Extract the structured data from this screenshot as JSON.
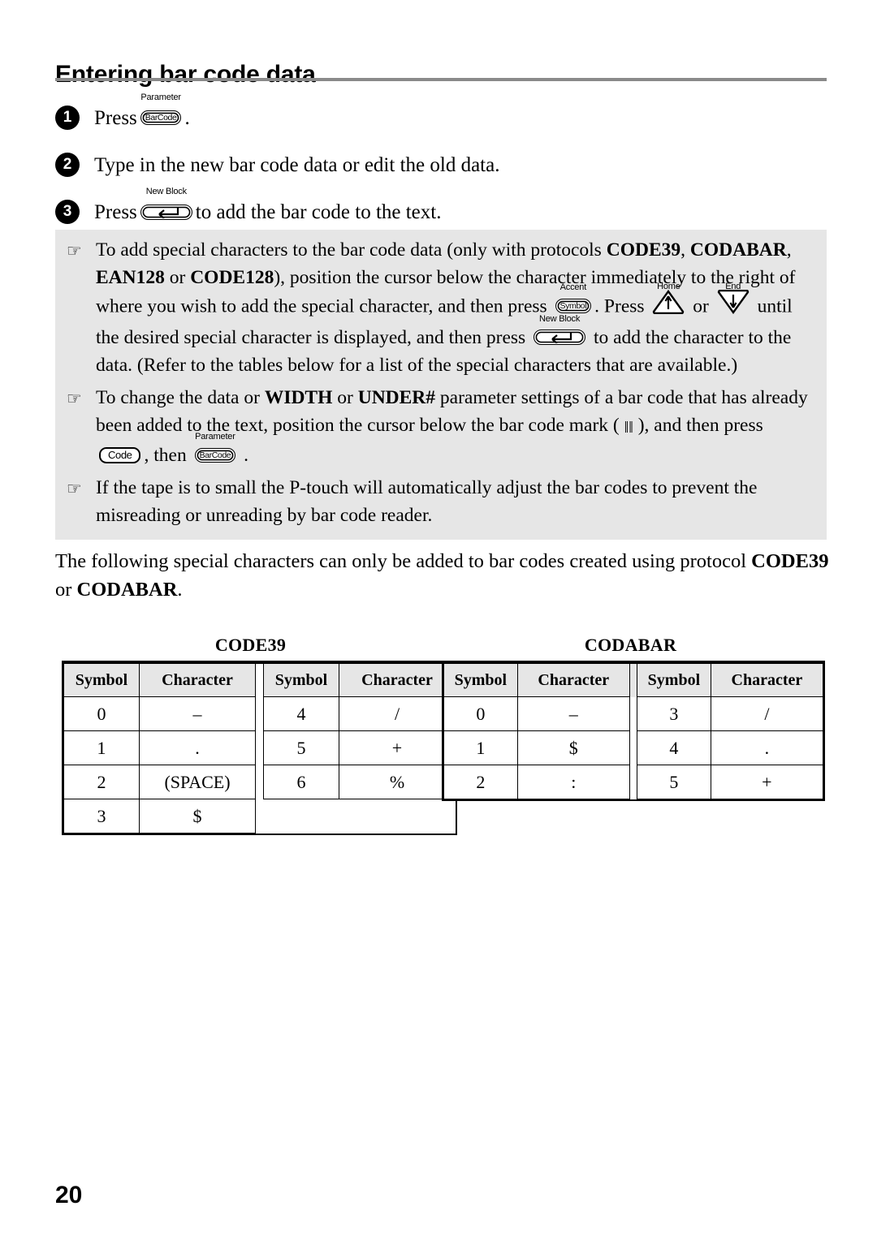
{
  "page": {
    "title": "Entering bar code data",
    "number": "20"
  },
  "steps": [
    {
      "num": "1",
      "pre": "Press",
      "key": {
        "label": "Parameter",
        "cap": "BarCode"
      },
      "post": "."
    },
    {
      "num": "2",
      "pre": "Type in the new bar code data or edit the old data.",
      "key": null,
      "post": ""
    },
    {
      "num": "3",
      "pre": "Press",
      "key": {
        "label": "New Block",
        "cap": "enter-arrow"
      },
      "post": "to add the bar code to the text."
    }
  ],
  "notes": {
    "bullet_icon": "pointing-hand-icon",
    "items": [
      {
        "segments": [
          {
            "t": "To add special characters to the bar code data (only with protocols "
          },
          {
            "t": "CODE39",
            "b": true
          },
          {
            "t": ", "
          },
          {
            "t": "CODABAR",
            "b": true
          },
          {
            "t": ", "
          },
          {
            "t": "EAN128",
            "b": true
          },
          {
            "t": " or "
          },
          {
            "t": "CODE128",
            "b": true
          },
          {
            "t": "), position the cursor below the character immediately to the right of where you wish to add the special character, and then press "
          },
          {
            "key": {
              "label": "Accent",
              "cap": "Symbol"
            }
          },
          {
            "t": ". Press "
          },
          {
            "key": {
              "label": "Home",
              "cap": "arrow-up-triangle"
            }
          },
          {
            "t": " or "
          },
          {
            "key": {
              "label": "End",
              "cap": "arrow-down-triangle"
            }
          },
          {
            "t": " until the desired special character is displayed, and then press "
          },
          {
            "key": {
              "label": "New Block",
              "cap": "enter-arrow"
            }
          },
          {
            "t": " to add the character to the data. (Refer to the tables below for a list of the special characters that are available.)"
          }
        ]
      },
      {
        "segments": [
          {
            "t": "To change the data or "
          },
          {
            "t": "WIDTH",
            "b": true
          },
          {
            "t": " or "
          },
          {
            "t": "UNDER#",
            "b": true
          },
          {
            "t": " parameter settings of a bar code that has already been added to the text, position the cursor below the bar code mark ( "
          },
          {
            "barmark": "bar-code-mark-icon"
          },
          {
            "t": " ), and then press "
          },
          {
            "key": {
              "label": "",
              "cap": "Code"
            }
          },
          {
            "t": ", then "
          },
          {
            "key": {
              "label": "Parameter",
              "cap": "BarCode"
            }
          },
          {
            "t": " ."
          }
        ]
      },
      {
        "segments": [
          {
            "t": "If the tape is to small the P-touch will automatically adjust the bar codes to prevent the misreading or unreading by bar code reader."
          }
        ]
      }
    ]
  },
  "paragraph": {
    "segments": [
      {
        "t": "The following special characters can only be added to bar codes created using protocol "
      },
      {
        "t": "CODE39",
        "b": true
      },
      {
        "t": " or "
      },
      {
        "t": "CODABAR",
        "b": true
      },
      {
        "t": "."
      }
    ]
  },
  "tables": [
    {
      "caption": "CODE39",
      "headers": [
        "Symbol",
        "Character",
        "Symbol",
        "Character"
      ],
      "rows": [
        [
          "0",
          "–",
          "4",
          "/"
        ],
        [
          "1",
          ".",
          "5",
          "+"
        ],
        [
          "2",
          "(SPACE)",
          "6",
          "%"
        ],
        [
          "3",
          "$",
          "",
          ""
        ]
      ]
    },
    {
      "caption": "CODABAR",
      "headers": [
        "Symbol",
        "Character",
        "Symbol",
        "Character"
      ],
      "rows": [
        [
          "0",
          "–",
          "3",
          "/"
        ],
        [
          "1",
          "$",
          "4",
          "."
        ],
        [
          "2",
          ":",
          "5",
          "+"
        ]
      ]
    }
  ]
}
